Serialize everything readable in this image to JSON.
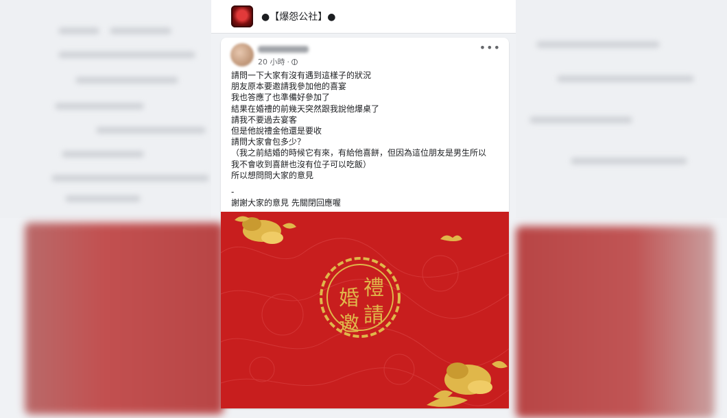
{
  "page": {
    "name": "●【爆怨公社】●",
    "avatar_icon": "page-logo-icon"
  },
  "post": {
    "time": "20 小時",
    "privacy_icon": "globe-icon",
    "menu_icon": "more-icon",
    "lines": [
      "請問一下大家有沒有遇到這樣子的狀況",
      "朋友原本要邀請我參加他的喜宴",
      "我也答應了也準備好參加了",
      "結果在婚禮的前幾天突然跟我說他爆桌了",
      "請我不要過去宴客",
      "但是他說禮金他還是要收",
      "請問大家會包多少？",
      "（我之前結婚的時候它有來，有給他喜餅，但因為這位朋友是男生所以",
      "我不會收到喜餅也沒有位子可以吃飯）",
      "所以想問問大家的意見"
    ],
    "dash": "-",
    "closing": "謝謝大家的意見 先關閉回應喔"
  },
  "image": {
    "seal_chars": [
      "禮",
      "婚",
      "請",
      "邀"
    ],
    "colors": {
      "red": "#c81e1e",
      "gold": "#e0b74a"
    }
  }
}
